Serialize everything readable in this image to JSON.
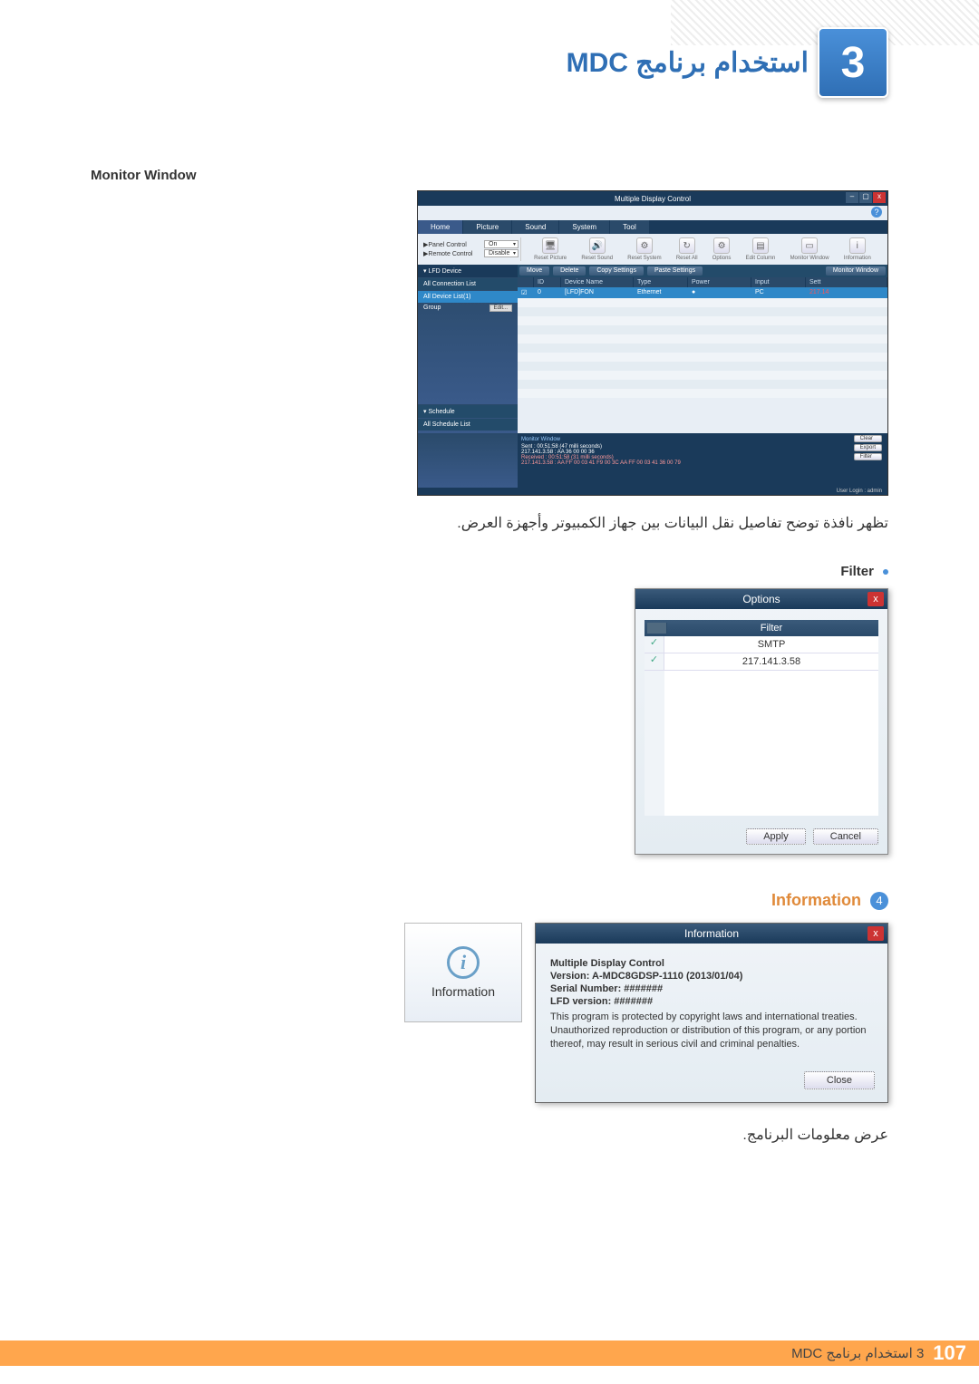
{
  "chapter": {
    "number": "3",
    "title_ar": "استخدام برنامج MDC"
  },
  "monitor_section": {
    "label": "Monitor Window",
    "window_title": "Multiple Display Control",
    "tabs": [
      "Home",
      "Picture",
      "Sound",
      "System",
      "Tool"
    ],
    "panel_control": {
      "row1_label": "▶Panel Control",
      "row1_val": "On",
      "row2_label": "▶Remote Control",
      "row2_val": "Disable"
    },
    "toolbar_icons": [
      {
        "name": "Reset Picture"
      },
      {
        "name": "Reset Sound"
      },
      {
        "name": "Reset System"
      },
      {
        "name": "Reset All"
      },
      {
        "name": "Options"
      },
      {
        "name": "Edit Column"
      },
      {
        "name": "Monitor Window"
      },
      {
        "name": "Information"
      }
    ],
    "sidebar": {
      "lfd_device": "▾ LFD Device",
      "all_conn": "All Connection List",
      "all_device": "All Device List(1)",
      "group": "Group",
      "edit": "Edit...",
      "schedule": "▾ Schedule",
      "all_schedule": "All Schedule List"
    },
    "subbar": {
      "move": "Move",
      "delete": "Delete",
      "copy": "Copy Settings",
      "paste": "Paste Settings",
      "monwin": "Monitor Window"
    },
    "table": {
      "headers": [
        "ID",
        "Device Name",
        "Type",
        "Power",
        "Input",
        "Sett"
      ],
      "row": {
        "id": "0",
        "name": "[LFD]FON",
        "type": "Ethernet",
        "power": "●",
        "input": "PC",
        "sett": "217.14"
      }
    },
    "monitor_window_panel": {
      "title": "Monitor Window",
      "sent_line1": "Sent : 00:51:58 (47 milli seconds)",
      "sent_line2": "217.141.3.58 : AA 36 00 00 36",
      "recv_line1": "Received : 00:51:58 (31 milli seconds)",
      "recv_line2": "217.141.3.58 : AA FF 00 03 41 F9 00 3C AA FF 00 03 41 36 00 79",
      "btn_clear": "Clear",
      "btn_export": "Export",
      "btn_filter": "Filter"
    },
    "footer_user": "User Login : admin"
  },
  "body_text1": "تظهر نافذة توضح تفاصيل نقل البيانات بين جهاز الكمبيوتر وأجهزة العرض.",
  "filter_section": {
    "label": "Filter",
    "dialog": {
      "title": "Options",
      "filter_header": "Filter",
      "rows": [
        "SMTP",
        "217.141.3.58"
      ],
      "apply": "Apply",
      "cancel": "Cancel"
    }
  },
  "info_section": {
    "number": "4",
    "label": "Information",
    "icon_label": "Information",
    "dialog": {
      "title": "Information",
      "heading": "Multiple Display Control",
      "version": "Version: A-MDC8GDSP-1110 (2013/01/04)",
      "serial": "Serial Number: #######",
      "lfdver": "LFD version: #######",
      "paragraph": "This program is protected by copyright laws and international treaties. Unauthorized reproduction or distribution of this program, or any portion thereof, may result in serious civil and criminal penalties.",
      "close": "Close"
    }
  },
  "body_text2": "عرض معلومات البرنامج.",
  "page_footer": {
    "number": "107",
    "text": "3 استخدام برنامج MDC"
  }
}
